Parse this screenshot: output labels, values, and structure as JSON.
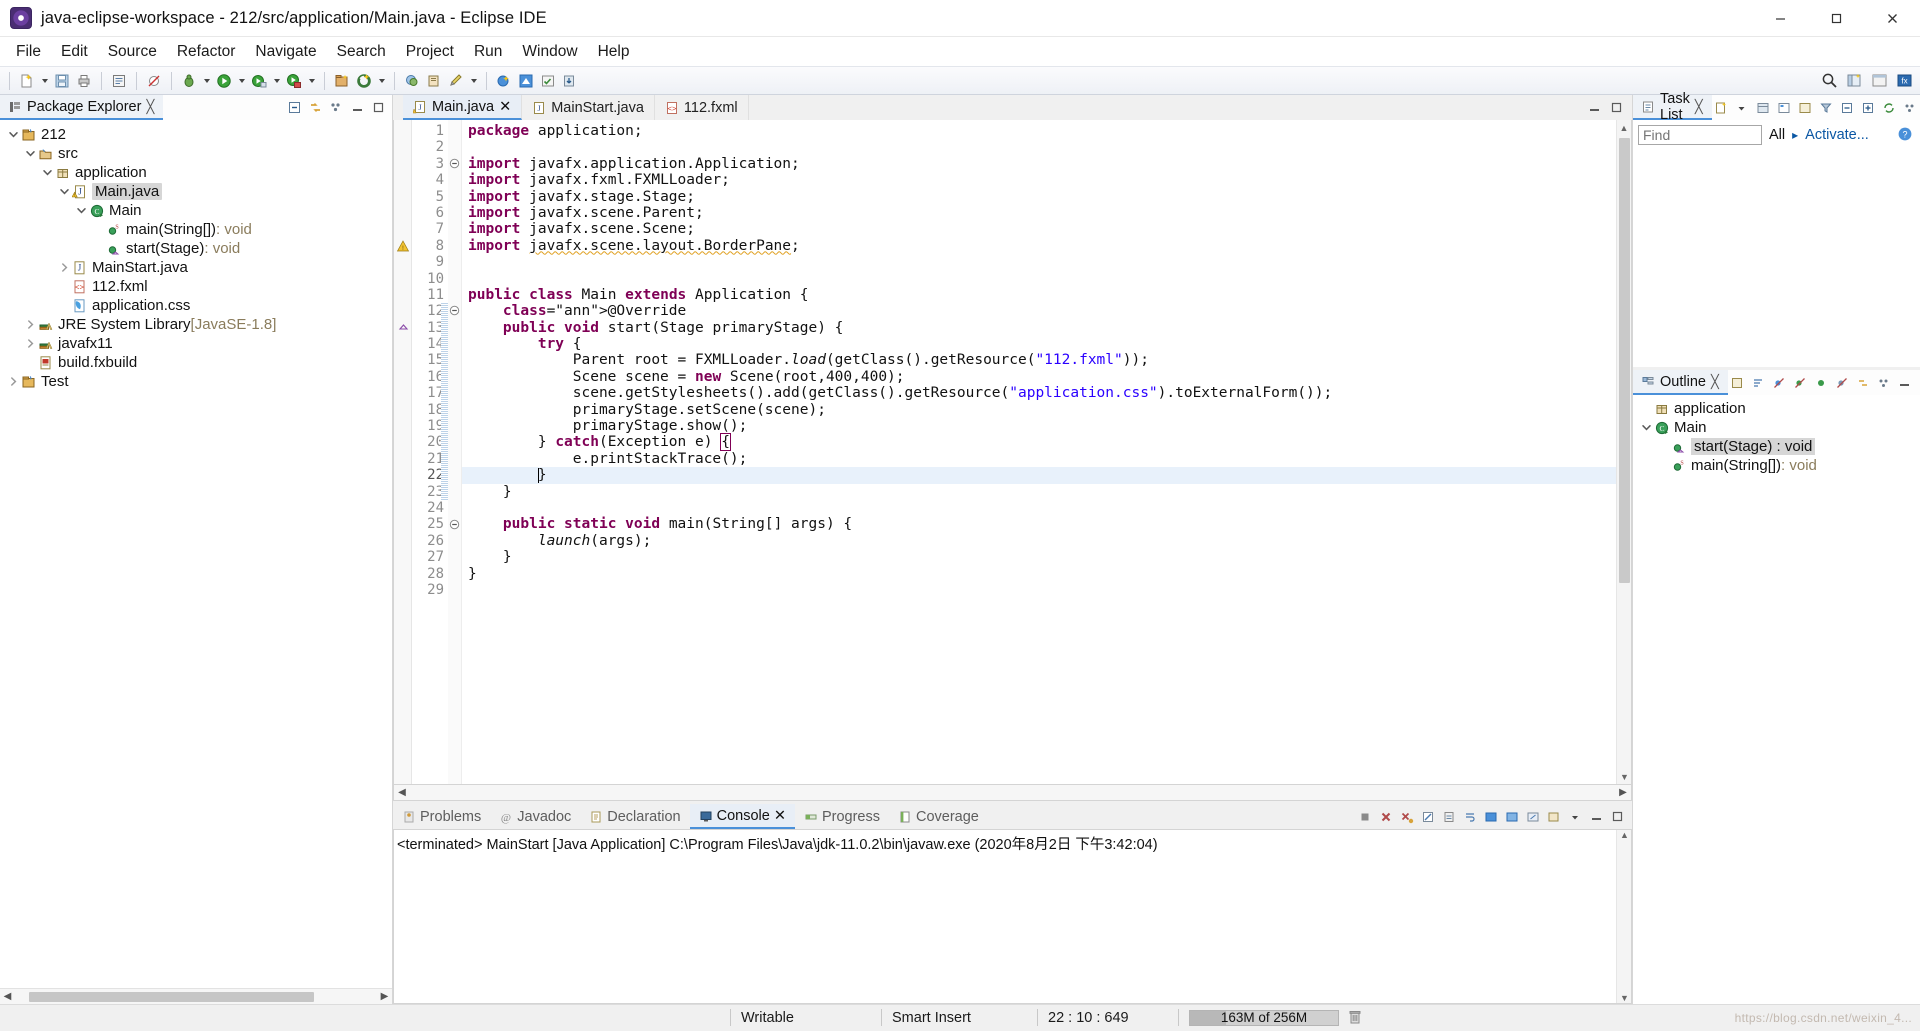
{
  "window": {
    "title": "java-eclipse-workspace - 212/src/application/Main.java - Eclipse IDE",
    "app_icon": "eclipse-icon",
    "minimize": "minimize-button",
    "maximize": "maximize-button",
    "close": "close-button"
  },
  "menubar": {
    "items": [
      "File",
      "Edit",
      "Source",
      "Refactor",
      "Navigate",
      "Search",
      "Project",
      "Run",
      "Window",
      "Help"
    ]
  },
  "package_explorer": {
    "title": "Package Explorer",
    "close_label": "╳",
    "toolbar": [
      "collapse-all-icon",
      "link-with-editor-icon",
      "view-menu-icon",
      "minimize-icon",
      "maximize-icon"
    ],
    "tree": [
      {
        "label": "212",
        "icon": "java-project-icon",
        "indent": 0,
        "twisty": "open",
        "selected": false
      },
      {
        "label": "src",
        "icon": "source-folder-icon",
        "indent": 1,
        "twisty": "open",
        "selected": false
      },
      {
        "label": "application",
        "icon": "package-icon",
        "indent": 2,
        "twisty": "open",
        "selected": false
      },
      {
        "label": "Main.java",
        "icon": "java-file-warning-icon",
        "indent": 3,
        "twisty": "open",
        "selected": true
      },
      {
        "label": "Main",
        "icon": "class-icon",
        "indent": 4,
        "twisty": "open",
        "selected": false
      },
      {
        "label": "main(String[])",
        "suffix": " : void",
        "icon": "method-static-icon",
        "indent": 5,
        "twisty": "none",
        "selected": false
      },
      {
        "label": "start(Stage)",
        "suffix": " : void",
        "icon": "method-icon",
        "indent": 5,
        "twisty": "none",
        "selected": false
      },
      {
        "label": "MainStart.java",
        "icon": "java-file-icon",
        "indent": 3,
        "twisty": "closed",
        "selected": false
      },
      {
        "label": "112.fxml",
        "icon": "fxml-file-icon",
        "indent": 3,
        "twisty": "none",
        "selected": false
      },
      {
        "label": "application.css",
        "icon": "css-file-icon",
        "indent": 3,
        "twisty": "none",
        "selected": false
      },
      {
        "label": "JRE System Library",
        "suffix": " [JavaSE-1.8]",
        "icon": "library-icon",
        "indent": 1,
        "twisty": "closed",
        "selected": false
      },
      {
        "label": "javafx11",
        "icon": "library-icon",
        "indent": 1,
        "twisty": "closed",
        "selected": false
      },
      {
        "label": "build.fxbuild",
        "icon": "fxbuild-file-icon",
        "indent": 1,
        "twisty": "none",
        "selected": false
      },
      {
        "label": "Test",
        "icon": "java-project-icon",
        "indent": 0,
        "twisty": "closed",
        "selected": false
      }
    ]
  },
  "editor": {
    "tabs": [
      {
        "label": "Main.java",
        "icon": "java-file-warning-icon",
        "active": true,
        "closable": true
      },
      {
        "label": "MainStart.java",
        "icon": "java-file-icon",
        "active": false,
        "closable": false
      },
      {
        "label": "112.fxml",
        "icon": "fxml-file-icon",
        "active": false,
        "closable": false
      }
    ],
    "minimize": "minimize-icon",
    "maximize": "maximize-icon",
    "current_line": 22,
    "code_lines": [
      {
        "n": 1,
        "fold": "",
        "marker": "",
        "text": "package application;"
      },
      {
        "n": 2,
        "fold": "",
        "marker": "",
        "text": ""
      },
      {
        "n": 3,
        "fold": "collapse",
        "marker": "",
        "text": "import javafx.application.Application;"
      },
      {
        "n": 4,
        "fold": "",
        "marker": "",
        "text": "import javafx.fxml.FXMLLoader;"
      },
      {
        "n": 5,
        "fold": "",
        "marker": "",
        "text": "import javafx.stage.Stage;"
      },
      {
        "n": 6,
        "fold": "",
        "marker": "",
        "text": "import javafx.scene.Parent;"
      },
      {
        "n": 7,
        "fold": "",
        "marker": "",
        "text": "import javafx.scene.Scene;"
      },
      {
        "n": 8,
        "fold": "",
        "marker": "warning",
        "text": "import javafx.scene.layout.BorderPane;"
      },
      {
        "n": 9,
        "fold": "",
        "marker": "",
        "text": ""
      },
      {
        "n": 10,
        "fold": "",
        "marker": "",
        "text": ""
      },
      {
        "n": 11,
        "fold": "",
        "marker": "",
        "text": "public class Main extends Application {"
      },
      {
        "n": 12,
        "fold": "collapse",
        "marker": "",
        "text": "    @Override"
      },
      {
        "n": 13,
        "fold": "",
        "marker": "override",
        "text": "    public void start(Stage primaryStage) {"
      },
      {
        "n": 14,
        "fold": "",
        "marker": "",
        "text": "        try {"
      },
      {
        "n": 15,
        "fold": "",
        "marker": "",
        "text": "            Parent root = FXMLLoader.load(getClass().getResource(\"112.fxml\"));"
      },
      {
        "n": 16,
        "fold": "",
        "marker": "",
        "text": "            Scene scene = new Scene(root,400,400);"
      },
      {
        "n": 17,
        "fold": "",
        "marker": "",
        "text": "            scene.getStylesheets().add(getClass().getResource(\"application.css\").toExternalForm());"
      },
      {
        "n": 18,
        "fold": "",
        "marker": "",
        "text": "            primaryStage.setScene(scene);"
      },
      {
        "n": 19,
        "fold": "",
        "marker": "",
        "text": "            primaryStage.show();"
      },
      {
        "n": 20,
        "fold": "",
        "marker": "",
        "text": "        } catch(Exception e) {"
      },
      {
        "n": 21,
        "fold": "",
        "marker": "",
        "text": "            e.printStackTrace();"
      },
      {
        "n": 22,
        "fold": "",
        "marker": "",
        "text": "        }"
      },
      {
        "n": 23,
        "fold": "",
        "marker": "",
        "text": "    }"
      },
      {
        "n": 24,
        "fold": "",
        "marker": "",
        "text": ""
      },
      {
        "n": 25,
        "fold": "collapse",
        "marker": "",
        "text": "    public static void main(String[] args) {"
      },
      {
        "n": 26,
        "fold": "",
        "marker": "",
        "text": "        launch(args);"
      },
      {
        "n": 27,
        "fold": "",
        "marker": "",
        "text": "    }"
      },
      {
        "n": 28,
        "fold": "",
        "marker": "",
        "text": "}"
      },
      {
        "n": 29,
        "fold": "",
        "marker": "",
        "text": ""
      }
    ]
  },
  "console": {
    "tabs": [
      {
        "label": "Problems",
        "icon": "problems-icon",
        "active": false
      },
      {
        "label": "Javadoc",
        "icon": "javadoc-icon",
        "active": false
      },
      {
        "label": "Declaration",
        "icon": "declaration-icon",
        "active": false
      },
      {
        "label": "Console",
        "icon": "console-icon",
        "active": true,
        "closable": true
      },
      {
        "label": "Progress",
        "icon": "progress-icon",
        "active": false
      },
      {
        "label": "Coverage",
        "icon": "coverage-icon",
        "active": false
      }
    ],
    "output": "<terminated> MainStart [Java Application] C:\\Program Files\\Java\\jdk-11.0.2\\bin\\javaw.exe (2020年8月2日 下午3:42:04)",
    "toolbar": [
      "terminate-icon",
      "remove-launch-icon",
      "remove-all-icon",
      "clear-console-icon",
      "scroll-lock-icon",
      "word-wrap-icon",
      "show-console-icon",
      "pin-console-icon",
      "display-selected-console-icon",
      "open-console-icon",
      "minimize-icon",
      "maximize-icon"
    ]
  },
  "task_list": {
    "title": "Task List",
    "close_label": "╳",
    "find_placeholder": "Find",
    "find_value": "",
    "all_label": "All",
    "activate_label": "Activate...",
    "help_icon": "help-icon",
    "toolbar": [
      "new-task-icon",
      "categorize-icon",
      "focus-icon",
      "presentation-icon",
      "filter-icon",
      "collapse-all-icon",
      "expand-all-icon",
      "synchronize-icon",
      "view-menu-icon",
      "minimize-icon",
      "maximize-icon"
    ]
  },
  "outline": {
    "title": "Outline",
    "close_label": "╳",
    "toolbar": [
      "focus-icon",
      "sort-icon",
      "hide-fields-icon",
      "hide-static-icon",
      "hide-nonpublic-icon",
      "hide-local-icon",
      "link-icon",
      "view-menu-icon",
      "minimize-icon",
      "maximize-icon"
    ],
    "items": [
      {
        "label": "application",
        "icon": "package-icon",
        "indent": 0,
        "twisty": "none",
        "selected": false
      },
      {
        "label": "Main",
        "icon": "class-icon",
        "indent": 0,
        "twisty": "open",
        "selected": false
      },
      {
        "label": "start(Stage)",
        "suffix": " : void",
        "icon": "method-icon",
        "indent": 1,
        "twisty": "none",
        "selected": true
      },
      {
        "label": "main(String[])",
        "suffix": " : void",
        "icon": "method-static-icon",
        "indent": 1,
        "twisty": "none",
        "selected": false
      }
    ]
  },
  "statusbar": {
    "writable": "Writable",
    "insert_mode": "Smart Insert",
    "position": "22 : 10 : 649",
    "memory": "163M of 256M",
    "memory_percent": 24,
    "trash_icon": "garbage-collect-icon",
    "watermark": "https://blog.csdn.net/weixin_4..."
  },
  "colors": {
    "accent": "#4a90d9",
    "keyword": "#7f0055",
    "string": "#2a00ff",
    "annotation": "#646464",
    "selection": "#d6d6d6",
    "current_line": "#e8f1fb",
    "link": "#0b57a4"
  }
}
